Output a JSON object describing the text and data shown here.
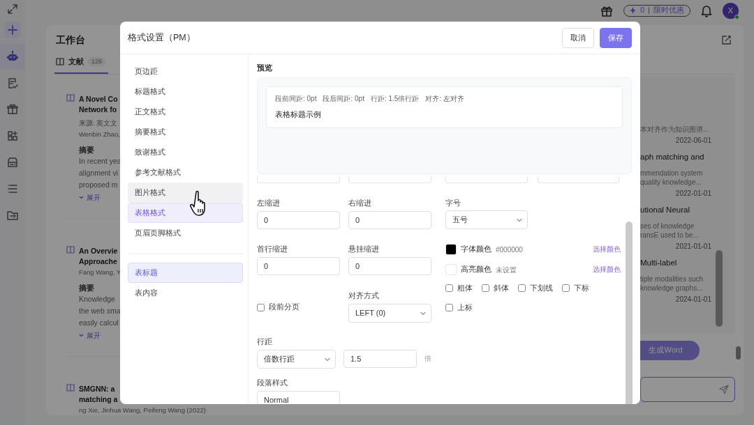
{
  "rail": {
    "items": [
      {
        "kind": "expand",
        "selected": false
      },
      {
        "kind": "add",
        "selected": false
      },
      {
        "kind": "robot",
        "selected": true
      },
      {
        "kind": "document-check",
        "selected": false
      },
      {
        "kind": "toolbox",
        "selected": false
      },
      {
        "kind": "apps",
        "selected": false
      },
      {
        "kind": "inbox",
        "selected": false
      },
      {
        "kind": "list",
        "selected": false
      },
      {
        "kind": "folder",
        "selected": false
      }
    ]
  },
  "topbar": {
    "points": "0",
    "promo": "限时优惠",
    "avatar": "X",
    "online": true
  },
  "workbench": {
    "title": "工作台",
    "tabs": [
      {
        "label": "文献",
        "count": "126",
        "selected": true
      }
    ],
    "papers": [
      {
        "title_lines": [
          "A Novel Co",
          "Network fo"
        ],
        "source": "来源: 英文文",
        "authors": "Wenbin Zhao,",
        "abstract_label": "摘要",
        "abstract_lines": [
          "In recent yea",
          "alignment vi",
          "proposed m"
        ],
        "expand": "展开"
      },
      {
        "title_lines": [
          "An Overvie",
          "Approache"
        ],
        "authors": "Fang Wang, Y",
        "abstract_label": "摘要",
        "abstract_lines": [
          "Knowledge",
          "the web sma",
          "easily calcul"
        ],
        "expand": "展开"
      },
      {
        "title_lines": [
          "SMGNN: a",
          "matching a"
        ],
        "authors": "ng Xie, Jinhua Wang, Peifeng Wang (2022)"
      }
    ],
    "right_items": [
      {
        "lines": [
          "本对齐作为知识图谱..."
        ],
        "date": "2022-06-01"
      },
      {
        "title": "aph matching and",
        "lines": [
          "mmendation system",
          "quality knowledge..."
        ],
        "date": "2022-01-01"
      },
      {
        "title": "utional Neural",
        "lines": [
          "ses of knowledge",
          "ransE used to be..."
        ],
        "date": "2021-01-01"
      },
      {
        "title": "Multi-label",
        "lines": [
          "tiple modalities such",
          "knowledge graphs..."
        ],
        "date": "2024-01-01"
      }
    ],
    "generate_button": "生成Word"
  },
  "modal": {
    "title": "格式设置（PM）",
    "buttons": [
      {
        "label": "取消",
        "kind": "secondary"
      },
      {
        "label": "保存",
        "kind": "primary"
      }
    ],
    "nav": [
      {
        "label": "页边距",
        "selected": false,
        "hovered": false
      },
      {
        "label": "标题格式",
        "selected": false,
        "hovered": false
      },
      {
        "label": "正文格式",
        "selected": false,
        "hovered": false
      },
      {
        "label": "摘要格式",
        "selected": false,
        "hovered": false
      },
      {
        "label": "致谢格式",
        "selected": false,
        "hovered": false
      },
      {
        "label": "参考文献格式",
        "selected": false,
        "hovered": false
      },
      {
        "label": "图片格式",
        "selected": false,
        "hovered": true
      },
      {
        "label": "表格格式",
        "selected": true,
        "hovered": false
      },
      {
        "label": "页眉页脚格式",
        "selected": false,
        "hovered": false
      }
    ],
    "subnav": [
      {
        "label": "表标题",
        "selected": true
      },
      {
        "label": "表内容",
        "selected": false
      }
    ],
    "preview": {
      "label": "预览",
      "meta": [
        "段前间距: 0pt",
        "段后间距: 0pt",
        "行距: 1.5倍行距",
        "对齐: 左对齐"
      ],
      "sample": "表格标题示例"
    },
    "left_indent": {
      "label": "左缩进",
      "value": "0"
    },
    "right_indent": {
      "label": "右缩进",
      "value": "0"
    },
    "first_indent": {
      "label": "首行缩进",
      "value": "0"
    },
    "hanging_indent": {
      "label": "悬挂缩进",
      "value": "0"
    },
    "page_break": {
      "label": "段前分页",
      "checked": false
    },
    "alignment": {
      "label": "对齐方式",
      "value": "LEFT (0)"
    },
    "line_spacing": {
      "label": "行距",
      "mode": "倍数行距",
      "value": "1.5",
      "unit": "倍"
    },
    "paragraph_style": {
      "label": "段落样式",
      "value": "Normal"
    },
    "font_size": {
      "label": "字号",
      "value": "五号"
    },
    "colors": [
      {
        "label": "字体颜色",
        "value": "#000000",
        "color": "#000000",
        "link": "选择颜色"
      },
      {
        "label": "高亮颜色",
        "value": "未设置",
        "color": "#ffffff",
        "link": "选择颜色"
      }
    ],
    "styles": [
      {
        "label": "粗体",
        "checked": false
      },
      {
        "label": "斜体",
        "checked": false
      },
      {
        "label": "下划线",
        "checked": false
      },
      {
        "label": "下标",
        "checked": false
      },
      {
        "label": "上标",
        "checked": false
      }
    ]
  }
}
